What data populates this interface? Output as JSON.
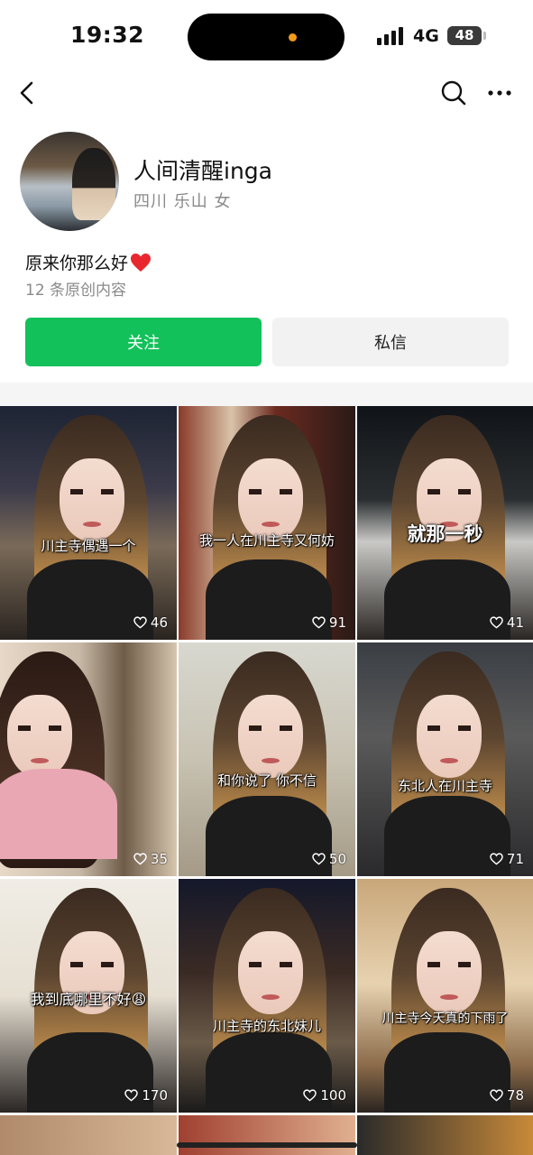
{
  "status_bar": {
    "time": "19:32",
    "network": "4G",
    "battery": "48",
    "island_dot_color": "#f39a1e"
  },
  "nav": {
    "back_icon": "chevron-left-icon",
    "search_icon": "search-icon",
    "more_icon": "more-dots-icon"
  },
  "profile": {
    "name": "人间清醒inga",
    "location": "四川 乐山 女",
    "bio": "原来你那么好",
    "bio_emoji": "red-heart-icon",
    "stats": "12 条原创内容",
    "follow_label": "关注",
    "message_label": "私信",
    "accent_color": "#13c15a"
  },
  "posts": [
    {
      "caption": "川主寺偶遇一个",
      "likes": "46",
      "style": "normal"
    },
    {
      "caption": "我一人在川主寺又何妨",
      "likes": "91",
      "style": "normal"
    },
    {
      "caption": "就那一秒",
      "likes": "41",
      "style": "big"
    },
    {
      "caption": "",
      "likes": "35",
      "style": "normal"
    },
    {
      "caption": "和你说了 你不信",
      "likes": "50",
      "style": "normal"
    },
    {
      "caption": "东北人在川主寺",
      "likes": "71",
      "style": "normal"
    },
    {
      "caption": "我到底哪里不好😩",
      "likes": "170",
      "style": "normal"
    },
    {
      "caption": "川主寺的东北妹儿",
      "likes": "100",
      "style": "normal"
    },
    {
      "caption": "川主寺今天真的下雨了",
      "likes": "78",
      "style": "normal"
    }
  ]
}
